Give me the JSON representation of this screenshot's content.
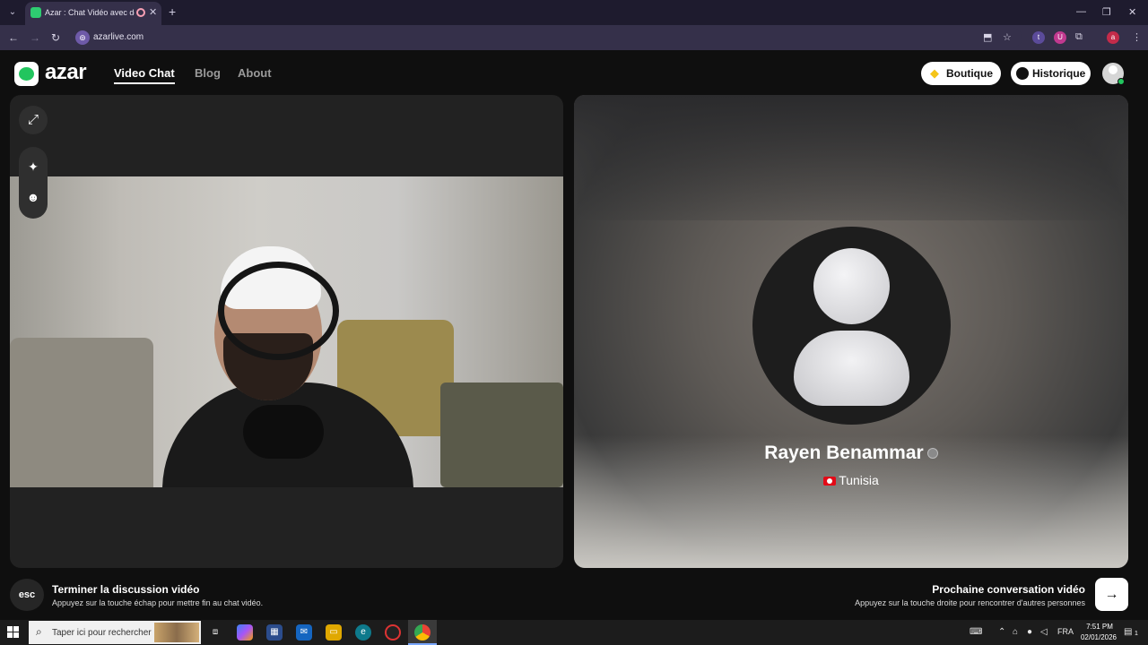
{
  "browser": {
    "tab_title": "Azar : Chat Vidéo avec de",
    "url": "azarlive.com",
    "ext_t": "t",
    "ext_u": "U",
    "ext_profile": "a",
    "icons": [
      "tab-search-icon",
      "new-tab-icon",
      "minimize-icon",
      "restore-icon",
      "close-icon",
      "back-icon",
      "forward-icon",
      "reload-icon",
      "install-icon",
      "bookmark-star-icon",
      "extensions-icon",
      "menu-icon"
    ]
  },
  "header": {
    "logo_text": "azar",
    "nav": {
      "video_chat": "Video Chat",
      "blog": "Blog",
      "about": "About"
    },
    "boutique_label": "Boutique",
    "historique_label": "Historique"
  },
  "peer": {
    "name": "Rayen Benammar",
    "country": "Tunisia"
  },
  "footer": {
    "esc_label": "esc",
    "end_title": "Terminer la discussion vidéo",
    "end_sub": "Appuyez sur la touche échap pour mettre fin au chat vidéo.",
    "next_title": "Prochaine conversation vidéo",
    "next_sub": "Appuyez sur la touche droite pour rencontrer d'autres personnes"
  },
  "taskbar": {
    "search_placeholder": "Taper ici pour rechercher",
    "language": "FRA",
    "time": "7:51 PM",
    "date": "02/01/2026",
    "notification_count": "1"
  },
  "colors": {
    "brand_green": "#22c55e",
    "panel_dark": "#222222",
    "flag_red": "#e30a17"
  }
}
